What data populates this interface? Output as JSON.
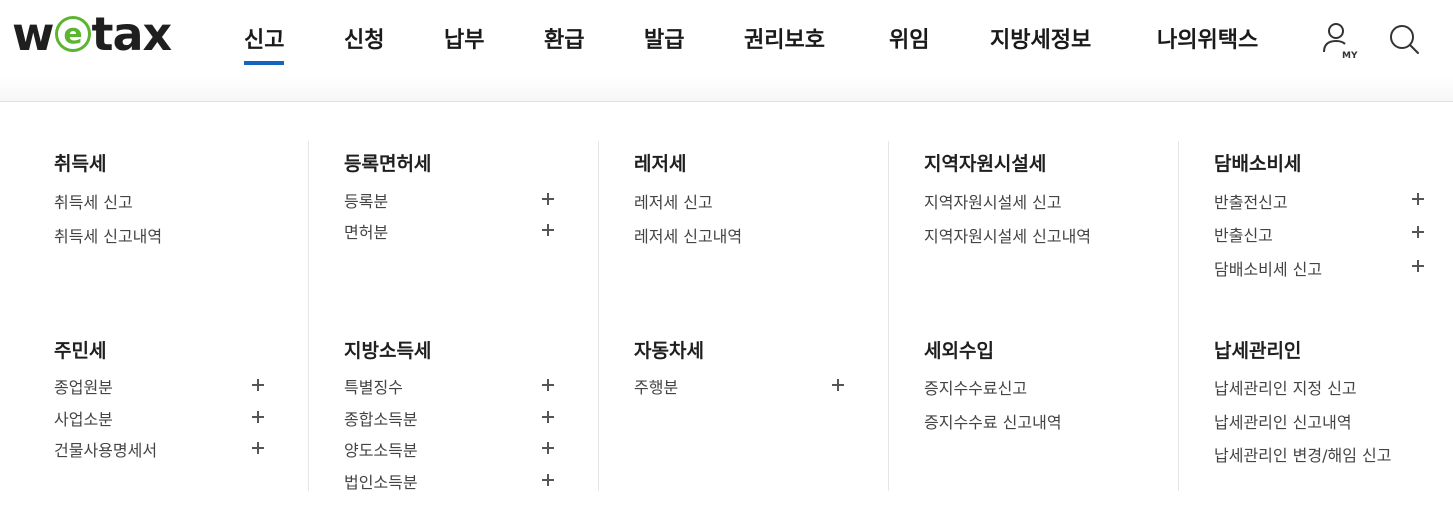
{
  "logo": {
    "text_before": "w",
    "text_e": "e",
    "text_after": "tax"
  },
  "nav": {
    "items": [
      "신고",
      "신청",
      "납부",
      "환급",
      "발급",
      "권리보호",
      "위임",
      "지방세정보",
      "나의위택스"
    ],
    "active_index": 0,
    "active_color": "#1565c0",
    "my_label": "MY"
  },
  "menu": {
    "columns": [
      {
        "groups": [
          {
            "title": "취득세",
            "links": [
              {
                "label": "취득세 신고",
                "expandable": false
              },
              {
                "label": "취득세 신고내역",
                "expandable": false
              }
            ]
          },
          {
            "title": "주민세",
            "links": [
              {
                "label": "종업원분",
                "expandable": true
              },
              {
                "label": "사업소분",
                "expandable": true
              },
              {
                "label": "건물사용명세서",
                "expandable": true
              }
            ]
          }
        ]
      },
      {
        "groups": [
          {
            "title": "등록면허세",
            "links": [
              {
                "label": "등록분",
                "expandable": true
              },
              {
                "label": "면허분",
                "expandable": true
              }
            ]
          },
          {
            "title": "지방소득세",
            "links": [
              {
                "label": "특별징수",
                "expandable": true
              },
              {
                "label": "종합소득분",
                "expandable": true
              },
              {
                "label": "양도소득분",
                "expandable": true
              },
              {
                "label": "법인소득분",
                "expandable": true
              }
            ]
          }
        ]
      },
      {
        "groups": [
          {
            "title": "레저세",
            "links": [
              {
                "label": "레저세 신고",
                "expandable": false
              },
              {
                "label": "레저세 신고내역",
                "expandable": false
              }
            ]
          },
          {
            "title": "자동차세",
            "links": [
              {
                "label": "주행분",
                "expandable": true
              }
            ]
          }
        ]
      },
      {
        "groups": [
          {
            "title": "지역자원시설세",
            "links": [
              {
                "label": "지역자원시설세 신고",
                "expandable": false
              },
              {
                "label": "지역자원시설세 신고내역",
                "expandable": false
              }
            ]
          },
          {
            "title": "세외수입",
            "links": [
              {
                "label": "증지수수료신고",
                "expandable": false
              },
              {
                "label": "증지수수료 신고내역",
                "expandable": false
              }
            ]
          }
        ]
      },
      {
        "groups": [
          {
            "title": "담배소비세",
            "links": [
              {
                "label": "반출전신고",
                "expandable": true
              },
              {
                "label": "반출신고",
                "expandable": true
              },
              {
                "label": "담배소비세 신고",
                "expandable": true
              }
            ]
          },
          {
            "title": "납세관리인",
            "links": [
              {
                "label": "납세관리인 지정 신고",
                "expandable": false
              },
              {
                "label": "납세관리인 신고내역",
                "expandable": false
              },
              {
                "label": "납세관리인 변경/해임 신고",
                "expandable": false
              }
            ]
          }
        ]
      }
    ]
  },
  "colors": {
    "logo_green": "#5cb531",
    "plus": "#555555",
    "divider": "#e6e6e6"
  }
}
